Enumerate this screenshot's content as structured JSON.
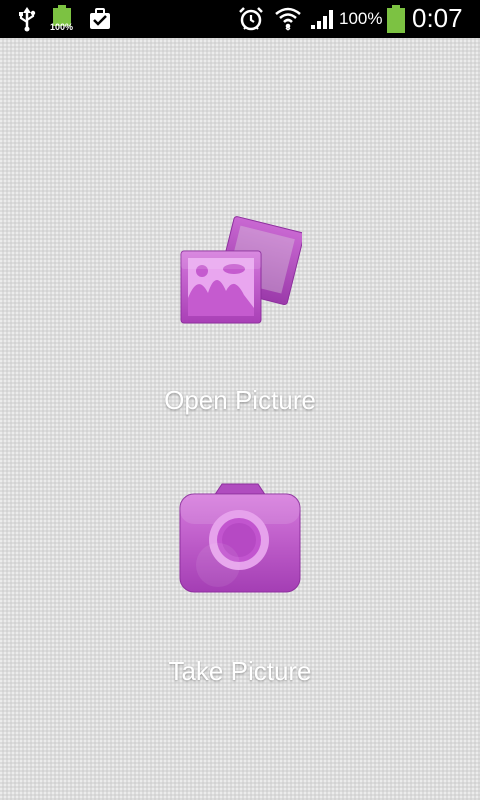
{
  "status_bar": {
    "battery_small_label": "100%",
    "battery_percent": "100%",
    "time": "0:07",
    "icons": [
      "usb-icon",
      "battery-full-icon",
      "clipboard-check-icon",
      "alarm-icon",
      "wifi-icon",
      "signal-icon",
      "battery-icon"
    ]
  },
  "actions": {
    "open_picture": {
      "label": "Open Picture",
      "icon": "photo-gallery-icon"
    },
    "take_picture": {
      "label": "Take Picture",
      "icon": "camera-icon"
    }
  },
  "colors": {
    "accent": "#b84fc4",
    "background": "#dcdcdc",
    "status_bar": "#000000"
  }
}
